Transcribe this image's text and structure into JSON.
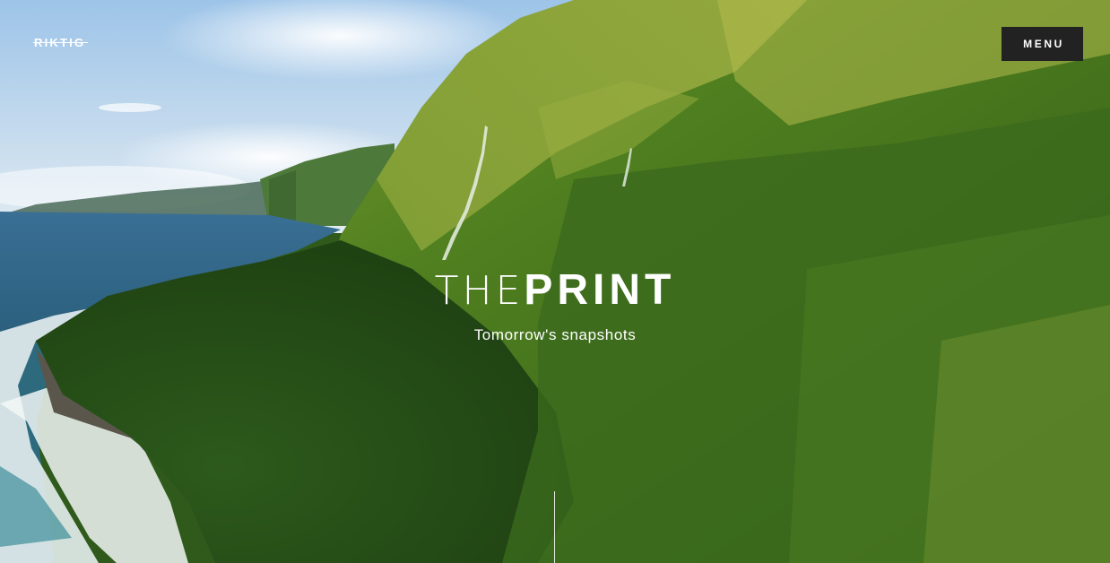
{
  "header": {
    "logo": "RIKTIG",
    "menu_label": "MENU"
  },
  "hero": {
    "title_light": "THE",
    "title_bold": "PRINT",
    "tagline": "Tomorrow's snapshots"
  },
  "colors": {
    "menu_bg": "#222222",
    "text": "#ffffff"
  },
  "icons": {
    "scroll_indicator": "vertical-line"
  }
}
